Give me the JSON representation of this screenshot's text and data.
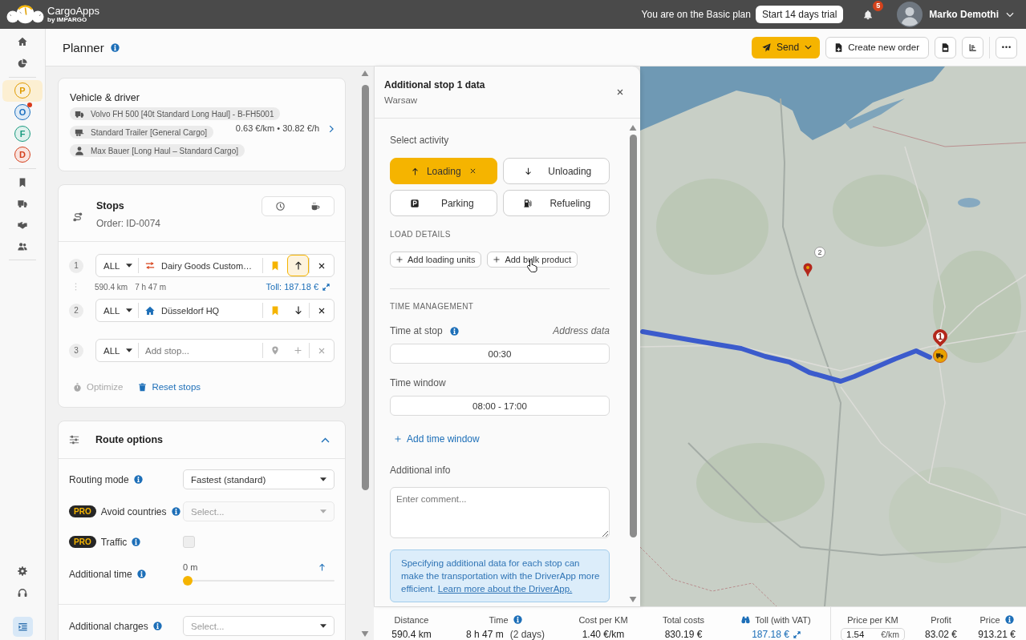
{
  "top_bar": {
    "brand": "CargoApps",
    "brand_byline": "by IMPARGO",
    "plan_text": "You are on the Basic plan",
    "trial_button": "Start 14 days trial",
    "notifications": "5",
    "user_name": "Marko Demothi"
  },
  "nav": {
    "top": [
      {
        "selected": false
      },
      {
        "selected": false
      }
    ],
    "apps": [
      {
        "letter": "P",
        "color": "#e09b00",
        "selected": true,
        "alert": false
      },
      {
        "letter": "O",
        "color": "#1c6fbf",
        "selected": false,
        "alert": true
      },
      {
        "letter": "F",
        "color": "#179a7e",
        "selected": false,
        "alert": false
      },
      {
        "letter": "D",
        "color": "#d43f1c",
        "selected": false,
        "alert": false
      }
    ],
    "tools": [
      {
        "selected": false
      },
      {
        "selected": false
      },
      {
        "selected": false
      },
      {
        "selected": false
      }
    ],
    "bottom": [
      {
        "selected": false
      },
      {
        "selected": false
      }
    ]
  },
  "page_header": {
    "title": "Planner",
    "info": true,
    "send_button": "Send",
    "create_button": "Create new order"
  },
  "vehicle_card": {
    "title": "Vehicle & driver",
    "assignments": [
      {
        "kind": "truck",
        "label": "Volvo FH 500 [40t Standard Long Haul] - B-FH5001"
      },
      {
        "kind": "trailer",
        "label": "Standard Trailer [General Cargo]"
      },
      {
        "kind": "driver",
        "label": "Max Bauer [Long Haul – Standard Cargo]"
      }
    ],
    "rates": "0.63 €/km • 30.82 €/h"
  },
  "stops_card": {
    "title": "Stops",
    "order": "Order: ID-0074",
    "stops": [
      {
        "number": "1",
        "filter": "ALL",
        "kind": "customer",
        "name": "Dairy Goods Custom…",
        "bookmarked": true,
        "loading": true,
        "active": true,
        "leg": {
          "distance": "590.4 km",
          "duration": "7 h 47 m",
          "toll": "Toll: 187.18 €"
        }
      },
      {
        "number": "2",
        "filter": "ALL",
        "kind": "depot",
        "name": "Düsseldorf HQ",
        "bookmarked": true,
        "loading": false,
        "active": false
      },
      {
        "number": "3",
        "filter": "ALL",
        "kind": "empty",
        "placeholder": "Add stop..."
      }
    ],
    "actions": [
      {
        "kind": "optimize",
        "label": "Optimize",
        "disabled": true
      },
      {
        "kind": "reset",
        "label": "Reset stops",
        "disabled": false
      }
    ]
  },
  "route_options": {
    "title": "Route options",
    "expanded": true,
    "rows": [
      {
        "kind": "select",
        "label": "Routing mode",
        "info": true,
        "value": "Fastest (standard)",
        "disabled": false
      },
      {
        "kind": "select",
        "badge": "PRO",
        "label": "Avoid countries",
        "info": true,
        "placeholder": "Select...",
        "disabled": true
      },
      {
        "kind": "checkbox",
        "badge": "PRO",
        "label": "Traffic",
        "info": true,
        "checked": false,
        "disabled": true
      },
      {
        "kind": "slider",
        "label": "Additional time",
        "info": true,
        "reading": "0 m",
        "level": 0
      },
      {
        "kind": "select",
        "label": "Additional charges",
        "info": true,
        "placeholder": "Select...",
        "disabled": false
      }
    ]
  },
  "stop_panel": {
    "title": "Additional stop 1 data",
    "subtitle": "Warsaw",
    "activity_label": "Select activity",
    "activities": [
      {
        "kind": "loading",
        "label": "Loading",
        "selected": true
      },
      {
        "kind": "unloading",
        "label": "Unloading",
        "selected": false
      },
      {
        "kind": "parking",
        "label": "Parking",
        "selected": false
      },
      {
        "kind": "refueling",
        "label": "Refueling",
        "selected": false
      }
    ],
    "load_heading": "LOAD DETAILS",
    "load_buttons": [
      "Add loading units",
      "Add bulk product"
    ],
    "time_heading": "TIME MANAGEMENT",
    "time_at_stop": {
      "label": "Time at stop",
      "info": true,
      "source": "Address data",
      "value": "00:30"
    },
    "time_window": {
      "label": "Time window",
      "value": "08:00 - 17:00"
    },
    "add_time_window": "Add time window",
    "info_label": "Additional info",
    "comment_placeholder": "Enter comment...",
    "notice": {
      "text": "Specifying additional data for each stop can make the transportation with the DriverApp more efficient.",
      "link": "Learn more about the DriverApp."
    }
  },
  "map": {
    "markers": [
      {
        "kind": "primary",
        "number": "1"
      },
      {
        "kind": "secondary",
        "number": "2"
      }
    ]
  },
  "summary_bar": {
    "stats": [
      {
        "kind": "text",
        "label": "Distance",
        "value": "590.4 km"
      },
      {
        "kind": "text",
        "label": "Time",
        "info": true,
        "value": "8 h 47 m",
        "note": "(2 days)"
      },
      {
        "kind": "text",
        "label": "Cost per KM",
        "value": "1.40 €/km"
      },
      {
        "kind": "text",
        "label": "Total costs",
        "value": "830.19 €"
      },
      {
        "kind": "toll",
        "label": "Toll (with VAT)",
        "value": "187.18 €"
      }
    ],
    "pricing": [
      {
        "kind": "input",
        "label": "Price per KM",
        "value": "1.54",
        "unit": "€/km"
      },
      {
        "kind": "text",
        "label": "Profit",
        "value": "83.02 €"
      },
      {
        "kind": "text",
        "label": "Price",
        "info": true,
        "value": "913.21 €"
      }
    ]
  }
}
